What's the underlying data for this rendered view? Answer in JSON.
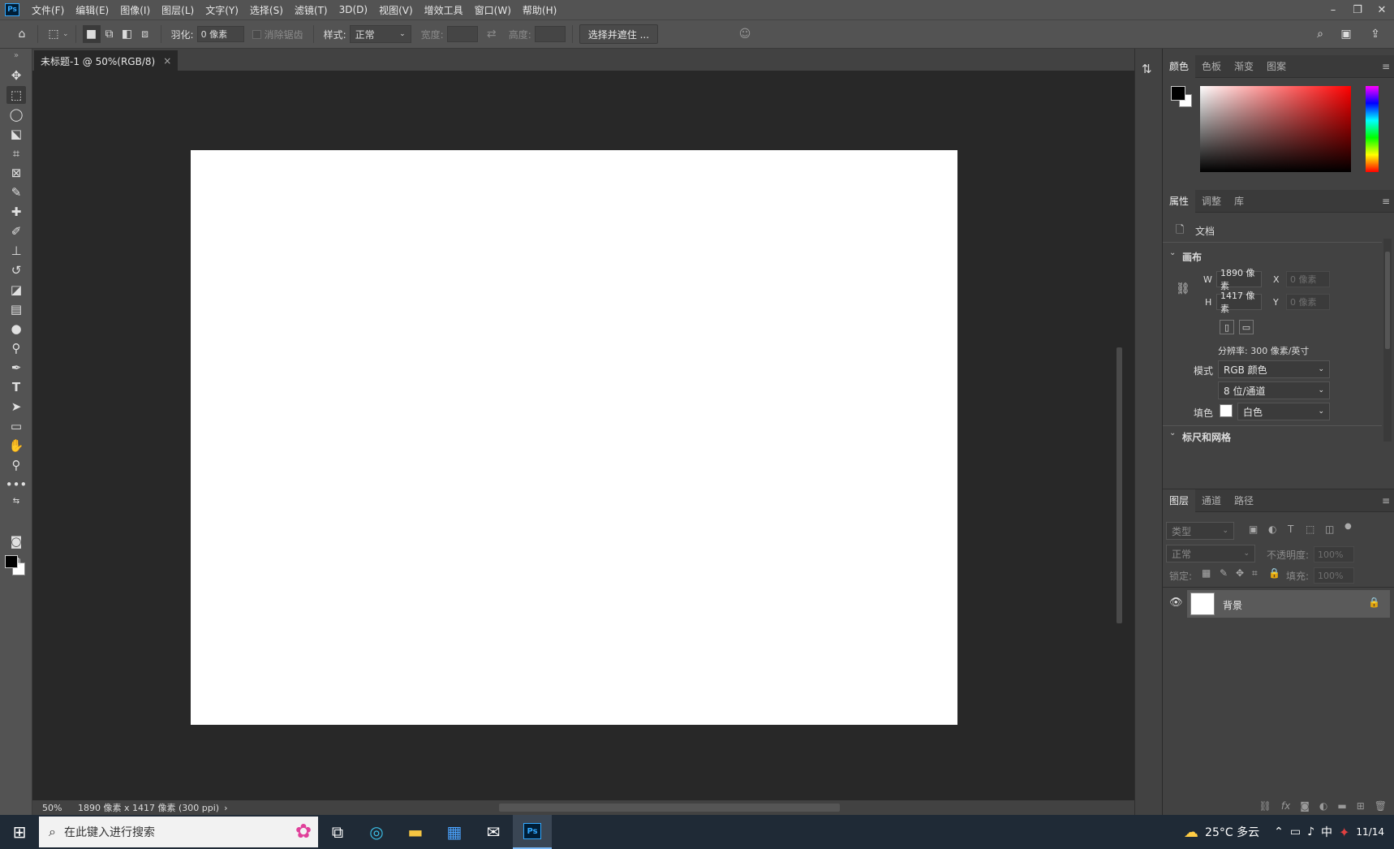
{
  "app": {
    "logo": "Ps"
  },
  "menu": [
    "文件(F)",
    "编辑(E)",
    "图像(I)",
    "图层(L)",
    "文字(Y)",
    "选择(S)",
    "滤镜(T)",
    "3D(D)",
    "视图(V)",
    "增效工具",
    "窗口(W)",
    "帮助(H)"
  ],
  "window_controls": {
    "minimize": "–",
    "restore": "❐",
    "close": "✕"
  },
  "options": {
    "feather_label": "羽化:",
    "feather_value": "0 像素",
    "antialias_label": "消除锯齿",
    "style_label": "样式:",
    "style_value": "正常",
    "width_label": "宽度:",
    "height_label": "高度:",
    "select_mask_button": "选择并遮住 ..."
  },
  "document": {
    "tab_title": "未标题-1 @ 50%(RGB/8)",
    "tab_close": "×",
    "canvas_color": "#ffffff"
  },
  "status": {
    "zoom": "50%",
    "info": "1890 像素 x 1417 像素 (300 ppi)",
    "arrow": "›"
  },
  "color_panel": {
    "tabs": [
      "颜色",
      "色板",
      "渐变",
      "图案"
    ],
    "foreground": "#000000",
    "background": "#ffffff",
    "hue": "#ff0000"
  },
  "properties_panel": {
    "tabs": [
      "属性",
      "调整",
      "库"
    ],
    "doc_label": "文档",
    "canvas_section": "画布",
    "w_label": "W",
    "w_value": "1890 像素",
    "h_label": "H",
    "h_value": "1417 像素",
    "x_label": "X",
    "x_value": "0 像素",
    "y_label": "Y",
    "y_value": "0 像素",
    "resolution": "分辨率: 300 像素/英寸",
    "mode_label": "模式",
    "mode_value": "RGB 颜色",
    "depth_value": "8 位/通道",
    "fill_label": "填色",
    "fill_value": "白色",
    "rulers_section": "标尺和网格"
  },
  "layers_panel": {
    "tabs": [
      "图层",
      "通道",
      "路径"
    ],
    "filter_placeholder": "类型",
    "blend_mode": "正常",
    "opacity_label": "不透明度:",
    "opacity_value": "100%",
    "lock_label": "锁定:",
    "fill_label": "填充:",
    "fill_value": "100%",
    "layer_name": "背景"
  },
  "taskbar": {
    "search_placeholder": "在此键入进行搜索",
    "weather": "25°C 多云",
    "ime": "中",
    "time": "11/14",
    "ps_label": "Ps"
  }
}
